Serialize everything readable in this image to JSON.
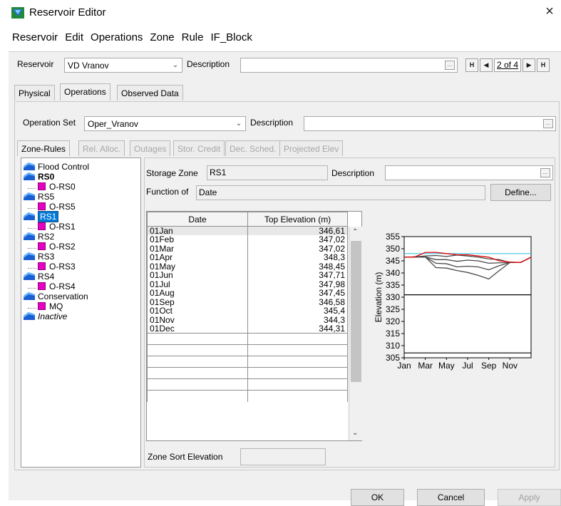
{
  "window": {
    "title": "Reservoir Editor",
    "close_glyph": "×"
  },
  "menu": [
    "Reservoir",
    "Edit",
    "Operations",
    "Zone",
    "Rule",
    "IF_Block"
  ],
  "reservoir_row": {
    "reservoir_label": "Reservoir",
    "reservoir_value": "VD Vranov",
    "description_label": "Description",
    "description_value": "",
    "nav_first": "H",
    "nav_prev": "◀",
    "nav_count": "2 of 4",
    "nav_next": "▶",
    "nav_last": "H"
  },
  "main_tabs": [
    {
      "label": "Physical",
      "active": false
    },
    {
      "label": "Operations",
      "active": true
    },
    {
      "label": "Observed Data",
      "active": false
    }
  ],
  "operation_row": {
    "set_label": "Operation Set",
    "set_value": "Oper_Vranov",
    "description_label": "Description",
    "description_value": ""
  },
  "sub_tabs": [
    {
      "label": "Zone-Rules",
      "enabled": true
    },
    {
      "label": "Rel. Alloc.",
      "enabled": false
    },
    {
      "label": "Outages",
      "enabled": false
    },
    {
      "label": "Stor. Credit",
      "enabled": false
    },
    {
      "label": "Dec. Sched.",
      "enabled": false
    },
    {
      "label": "Projected Elev",
      "enabled": false
    }
  ],
  "tree": [
    {
      "label": "Flood Control",
      "type": "zone",
      "bold": false,
      "italic": false,
      "selected": false
    },
    {
      "label": "RS0",
      "type": "zone",
      "bold": true,
      "italic": false,
      "selected": false
    },
    {
      "label": "O-RS0",
      "type": "rule"
    },
    {
      "label": "RS5",
      "type": "zone",
      "bold": false,
      "italic": false,
      "selected": false
    },
    {
      "label": "O-RS5",
      "type": "rule"
    },
    {
      "label": "RS1",
      "type": "zone",
      "bold": false,
      "italic": false,
      "selected": true
    },
    {
      "label": "O-RS1",
      "type": "rule"
    },
    {
      "label": "RS2",
      "type": "zone",
      "bold": false,
      "italic": false,
      "selected": false
    },
    {
      "label": "O-RS2",
      "type": "rule"
    },
    {
      "label": "RS3",
      "type": "zone",
      "bold": false,
      "italic": false,
      "selected": false
    },
    {
      "label": "O-RS3",
      "type": "rule"
    },
    {
      "label": "RS4",
      "type": "zone",
      "bold": false,
      "italic": false,
      "selected": false
    },
    {
      "label": "O-RS4",
      "type": "rule"
    },
    {
      "label": "Conservation",
      "type": "zone",
      "bold": false,
      "italic": false,
      "selected": false
    },
    {
      "label": "MQ",
      "type": "rule"
    },
    {
      "label": "Inactive",
      "type": "zone",
      "bold": false,
      "italic": true,
      "selected": false
    }
  ],
  "zone_detail": {
    "storage_zone_label": "Storage Zone",
    "storage_zone_value": "RS1",
    "description_label": "Description",
    "description_value": "",
    "function_label": "Function of",
    "function_value": "Date",
    "define_button": "Define...",
    "sort_label": "Zone Sort Elevation",
    "sort_value": ""
  },
  "table": {
    "headers": [
      "Date",
      "Top Elevation (m)"
    ],
    "rows": [
      [
        "01Jan",
        "346,61"
      ],
      [
        "01Feb",
        "347,02"
      ],
      [
        "01Mar",
        "347,02"
      ],
      [
        "01Apr",
        "348,3"
      ],
      [
        "01May",
        "348,45"
      ],
      [
        "01Jun",
        "347,71"
      ],
      [
        "01Jul",
        "347,98"
      ],
      [
        "01Aug",
        "347,45"
      ],
      [
        "01Sep",
        "346,58"
      ],
      [
        "01Oct",
        "345,4"
      ],
      [
        "01Nov",
        "344,3"
      ],
      [
        "01Dec",
        "344,31"
      ]
    ],
    "empty_rows": 6
  },
  "chart_data": {
    "type": "line",
    "ylabel": "Elevation (m)",
    "ylim": [
      305,
      355
    ],
    "yticks": [
      305,
      310,
      315,
      320,
      325,
      330,
      335,
      340,
      345,
      350,
      355
    ],
    "xticks": [
      "Jan",
      "Mar",
      "May",
      "Jul",
      "Sep",
      "Nov"
    ],
    "x_months": [
      1,
      2,
      3,
      4,
      5,
      6,
      7,
      8,
      9,
      10,
      11,
      12,
      13
    ],
    "hlines": [
      {
        "y": 348,
        "color": "#3fc6e8"
      },
      {
        "y": 331,
        "color": "#000000"
      },
      {
        "y": 307,
        "color": "#000000"
      }
    ],
    "series": [
      {
        "color": "#e00000",
        "values": [
          346.5,
          346.6,
          348.5,
          348.5,
          348.0,
          347.5,
          347.5,
          347.0,
          346.5,
          345.0,
          344.5,
          344.3,
          346.5
        ]
      },
      {
        "color": "#4a4a4a",
        "values": [
          346.5,
          346.6,
          347.0,
          347.2,
          346.8,
          347.4,
          347.0,
          346.5,
          345.8,
          345.5,
          344.3,
          344.3,
          346.5
        ]
      },
      {
        "color": "#4a4a4a",
        "values": [
          346.5,
          346.6,
          346.6,
          345.5,
          345.5,
          344.8,
          345.3,
          345.0,
          344.0,
          344.2,
          344.3,
          344.3,
          346.5
        ]
      },
      {
        "color": "#4a4a4a",
        "values": [
          346.5,
          346.6,
          346.6,
          344.0,
          343.8,
          342.5,
          342.8,
          342.5,
          341.3,
          343.0,
          344.3,
          344.3,
          346.5
        ]
      },
      {
        "color": "#4a4a4a",
        "values": [
          346.5,
          346.6,
          346.6,
          342.2,
          342.0,
          341.0,
          340.2,
          339.0,
          337.5,
          341.0,
          344.3,
          344.3,
          346.5
        ]
      }
    ]
  },
  "footer": {
    "ok": "OK",
    "cancel": "Cancel",
    "apply": "Apply"
  }
}
